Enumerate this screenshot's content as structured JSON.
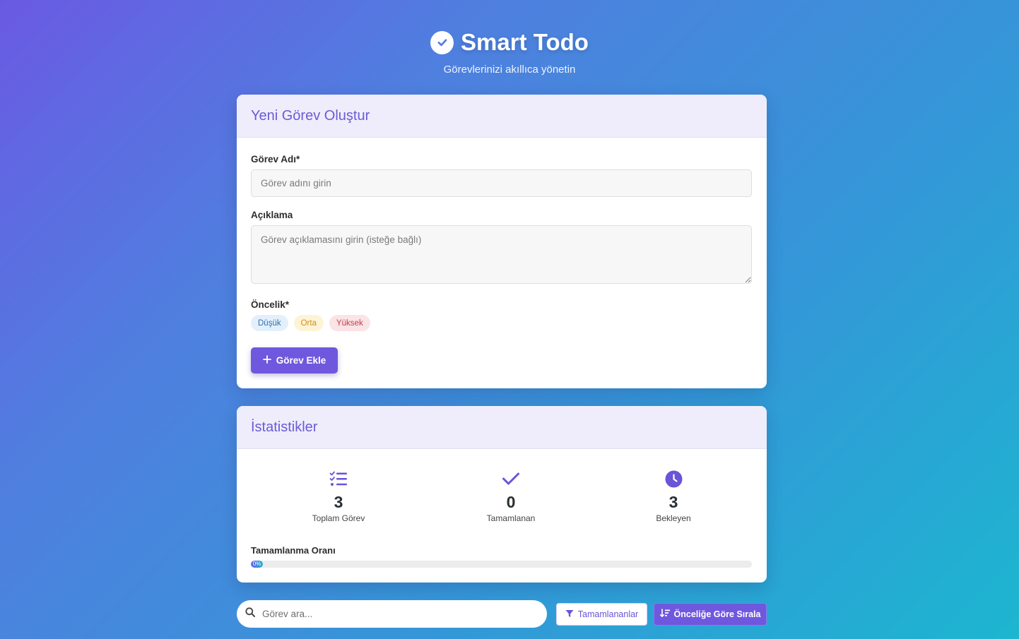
{
  "header": {
    "title": "Smart Todo",
    "subtitle": "Görevlerinizi akıllıca yönetin",
    "icon": "check-circle-icon"
  },
  "form": {
    "title": "Yeni Görev Oluştur",
    "name_label": "Görev Adı*",
    "name_value": "",
    "name_placeholder": "Görev adını girin",
    "desc_label": "Açıklama",
    "desc_value": "",
    "desc_placeholder": "Görev açıklamasını girin (isteğe bağlı)",
    "priority_label": "Öncelik*",
    "priority_options": [
      "Düşük",
      "Orta",
      "Yüksek"
    ],
    "add_button": "Görev Ekle"
  },
  "stats": {
    "title": "İstatistikler",
    "items": [
      {
        "value": "3",
        "label": "Toplam Görev",
        "icon": "checklist-icon"
      },
      {
        "value": "0",
        "label": "Tamamlanan",
        "icon": "check-icon"
      },
      {
        "value": "3",
        "label": "Bekleyen",
        "icon": "clock-icon"
      }
    ],
    "progress_label": "Tamamlanma Oranı",
    "progress_text": "0%",
    "progress_percent": 0
  },
  "toolbar": {
    "search_placeholder": "Görev ara...",
    "search_value": "",
    "filter_button": "Tamamlananlar",
    "sort_button": "Önceliğe Göre Sırala"
  },
  "colors": {
    "accent": "#6f58de",
    "header_bg": "#efedfb",
    "low": "#2f6fb0",
    "medium": "#d18f10",
    "high": "#c43d4c"
  }
}
